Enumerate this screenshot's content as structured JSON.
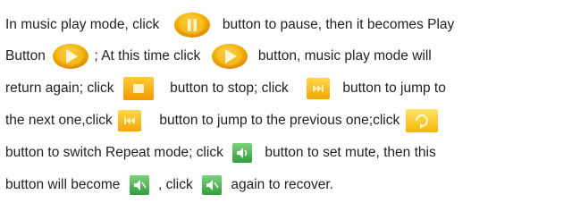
{
  "colors": {
    "text": "#231f20",
    "icon_orange": "#f5a800",
    "icon_yellow": "#ffd21f",
    "icon_green": "#4caf50"
  },
  "document": {
    "lines": [
      {
        "segments": [
          "In music play mode, click ",
          " button to pause, then it becomes Play"
        ]
      },
      {
        "segments": [
          "Button ",
          " ; At this time click ",
          " button, music play mode will"
        ]
      },
      {
        "segments": [
          "return again; click ",
          " button to stop; click ",
          " button to jump to"
        ]
      },
      {
        "segments": [
          "the next one,click ",
          " button to jump to the previous one;click "
        ]
      },
      {
        "segments": [
          "button to switch Repeat mode; click ",
          " button to set mute, then this"
        ]
      },
      {
        "segments": [
          "button will become ",
          " , click ",
          " again to recover."
        ]
      }
    ]
  },
  "icons": [
    {
      "name": "pause-icon",
      "color": "#f5a800"
    },
    {
      "name": "play-icon",
      "color": "#f5a800"
    },
    {
      "name": "play-icon",
      "color": "#f5a800"
    },
    {
      "name": "stop-icon",
      "color": "#f5a800"
    },
    {
      "name": "next-track-icon",
      "color": "#f5a800"
    },
    {
      "name": "previous-track-icon",
      "color": "#f5a800"
    },
    {
      "name": "repeat-mode-icon",
      "color": "#ffd21f"
    },
    {
      "name": "speaker-icon",
      "color": "#4caf50"
    },
    {
      "name": "speaker-muted-icon",
      "color": "#4caf50"
    },
    {
      "name": "speaker-muted-icon",
      "color": "#4caf50"
    }
  ]
}
